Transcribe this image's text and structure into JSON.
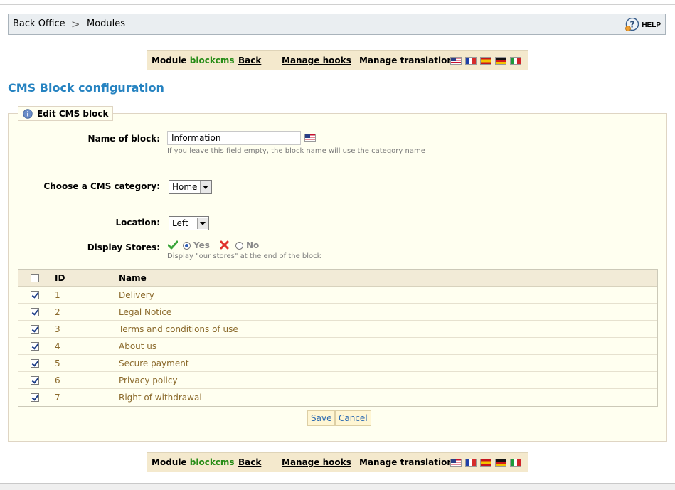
{
  "breadcrumb": {
    "root": "Back Office",
    "separator": ">",
    "current": "Modules",
    "help_label": "HELP"
  },
  "module_bar": {
    "module_prefix": "Module",
    "module_name": "blockcms",
    "back": "Back",
    "manage_hooks": "Manage hooks",
    "manage_translations": "Manage translations:",
    "flags": [
      "flag-us-icon",
      "flag-fr-icon",
      "flag-es-icon",
      "flag-de-icon",
      "flag-it-icon"
    ]
  },
  "page_title": "CMS Block configuration",
  "fieldset": {
    "legend": "Edit CMS block",
    "name_label": "Name of block:",
    "name_value": "Information",
    "name_hint": "If you leave this field empty, the block name will use the category name",
    "category_label": "Choose a CMS category:",
    "category_value": "Home",
    "location_label": "Location:",
    "location_value": "Left",
    "stores_label": "Display Stores:",
    "yes": "Yes",
    "no": "No",
    "stores_hint": "Display \"our stores\" at the end of the block"
  },
  "table": {
    "col_id": "ID",
    "col_name": "Name",
    "rows": [
      {
        "id": "1",
        "name": "Delivery"
      },
      {
        "id": "2",
        "name": "Legal Notice"
      },
      {
        "id": "3",
        "name": "Terms and conditions of use"
      },
      {
        "id": "4",
        "name": "About us"
      },
      {
        "id": "5",
        "name": "Secure payment"
      },
      {
        "id": "6",
        "name": "Privacy policy"
      },
      {
        "id": "7",
        "name": "Right of withdrawal"
      }
    ]
  },
  "buttons": {
    "save": "Save",
    "cancel": "Cancel"
  },
  "colors": {
    "accent": "#2683c1",
    "module_green": "#268c16",
    "row_text": "#8b6a2c"
  }
}
